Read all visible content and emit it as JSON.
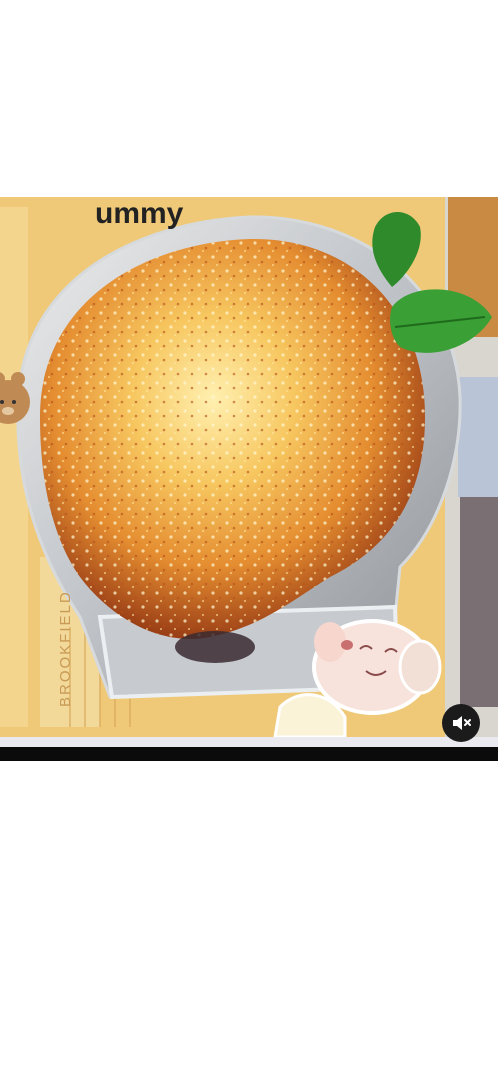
{
  "video": {
    "overlay_text": "ummy",
    "box_text": "BROOKFIELD"
  },
  "controls": {
    "mute_icon": "speaker-muted-icon",
    "muted": true
  }
}
